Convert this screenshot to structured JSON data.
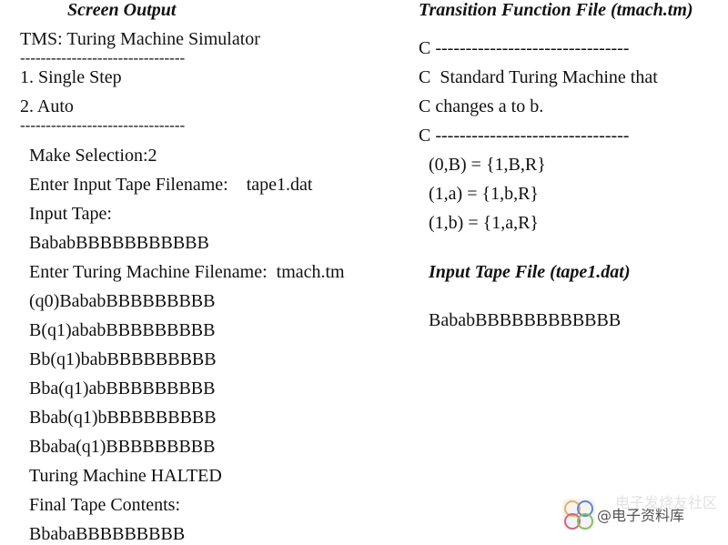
{
  "screen_output": {
    "heading": "Screen Output",
    "menu": {
      "title": "TMS: Turing Machine Simulator",
      "separator": "--------------------------------",
      "options": [
        "1. Single Step",
        "2. Auto"
      ],
      "separator_bottom": "--------------------------------"
    },
    "session": [
      "Make Selection:2",
      "Enter Input Tape Filename:    tape1.dat",
      "Input Tape:",
      "BababBBBBBBBBBBB",
      "Enter Turing Machine Filename:  tmach.tm",
      "(q0)BababBBBBBBBBB",
      "B(q1)ababBBBBBBBBB",
      "Bb(q1)babBBBBBBBBB",
      "Bba(q1)abBBBBBBBBB",
      "Bbab(q1)bBBBBBBBBB",
      "Bbaba(q1)BBBBBBBBB",
      "Turing Machine HALTED",
      "Final Tape Contents:",
      "BbabaBBBBBBBBB"
    ]
  },
  "transition_file": {
    "heading": "Transition Function File (tmach.tm)",
    "comments": [
      "C --------------------------------",
      "C  Standard Turing Machine that",
      "C changes a to b.",
      "C --------------------------------"
    ],
    "rules": [
      "(0,B) = {1,B,R}",
      "(1,a) = {1,b,R}",
      "(1,b) = {1,a,R}"
    ]
  },
  "input_tape_file": {
    "heading": "Input Tape File (tape1.dat)",
    "content": "BababBBBBBBBBBBBB"
  },
  "watermark": {
    "text": "@电子资料库",
    "faded_text": "电子发烧友社区"
  }
}
